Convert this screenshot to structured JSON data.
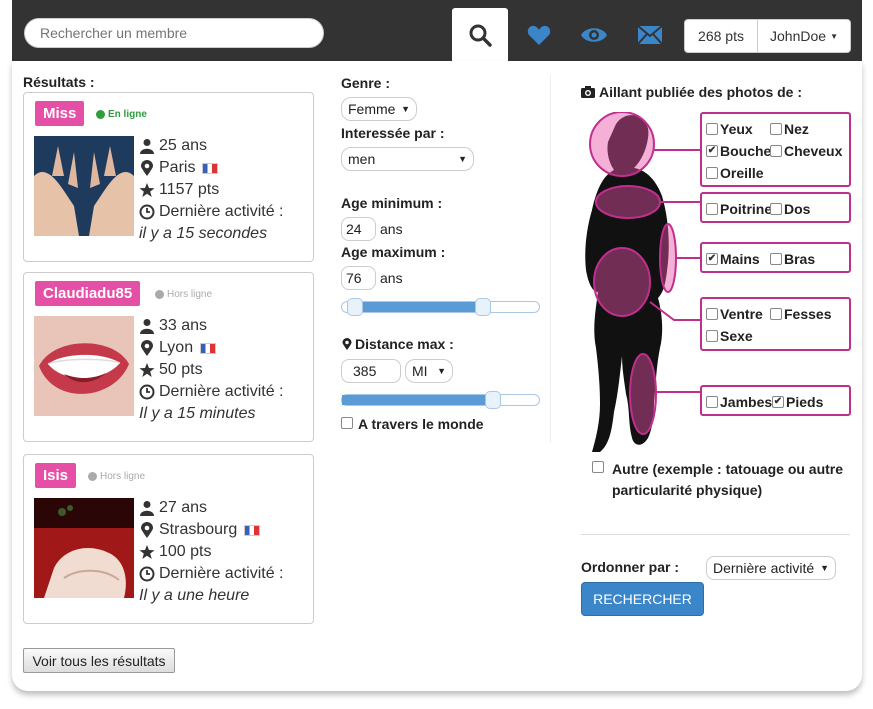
{
  "header": {
    "search_placeholder": "Rechercher un membre",
    "points": "268 pts",
    "username": "JohnDoe"
  },
  "results": {
    "label": "Résultats :",
    "items": [
      {
        "name": "Miss",
        "status": "En ligne",
        "age": "25 ans",
        "city": "Paris",
        "points": "1157 pts",
        "last_label": "Dernière activité :",
        "last_value": "il y a 15 secondes"
      },
      {
        "name": "Claudiadu85",
        "status": "Hors ligne",
        "age": "33 ans",
        "city": "Lyon",
        "points": "50 pts",
        "last_label": "Dernière activité :",
        "last_value": "Il y a 15 minutes"
      },
      {
        "name": "Isis",
        "status": "Hors ligne",
        "age": "27 ans",
        "city": "Strasbourg",
        "points": "100 pts",
        "last_label": "Dernière activité :",
        "last_value": "Il y a une heure"
      }
    ],
    "view_all": "Voir tous les résultats"
  },
  "filters": {
    "genre_label": "Genre :",
    "genre_value": "Femme",
    "interest_label": "Interessée par :",
    "interest_value": "men",
    "age_min_label": "Age minimum :",
    "age_min": "24",
    "age_unit": "ans",
    "age_max_label": "Age maximum :",
    "age_max": "76",
    "distance_label": "Distance max :",
    "distance": "385",
    "distance_unit": "MI",
    "worldwide_label": "A travers le monde"
  },
  "photos": {
    "label": "Aillant publiée des photos de :",
    "parts": {
      "yeux": "Yeux",
      "nez": "Nez",
      "bouche": "Bouche",
      "cheveux": "Cheveux",
      "oreille": "Oreille",
      "poitrine": "Poitrine",
      "dos": "Dos",
      "mains": "Mains",
      "bras": "Bras",
      "ventre": "Ventre",
      "fesses": "Fesses",
      "sexe": "Sexe",
      "jambes": "Jambes",
      "pieds": "Pieds"
    },
    "other_label": "Autre (exemple : tatouage ou autre particularité physique)"
  },
  "order": {
    "label": "Ordonner par :",
    "value": "Dernière activité",
    "search_button": "RECHERCHER"
  },
  "colors": {
    "accent_pink": "#e64fa6",
    "zone_border": "#c02f8e",
    "button_blue": "#3b86c9",
    "icon_blue": "#3b86c9",
    "online_green": "#2e9e3e"
  }
}
